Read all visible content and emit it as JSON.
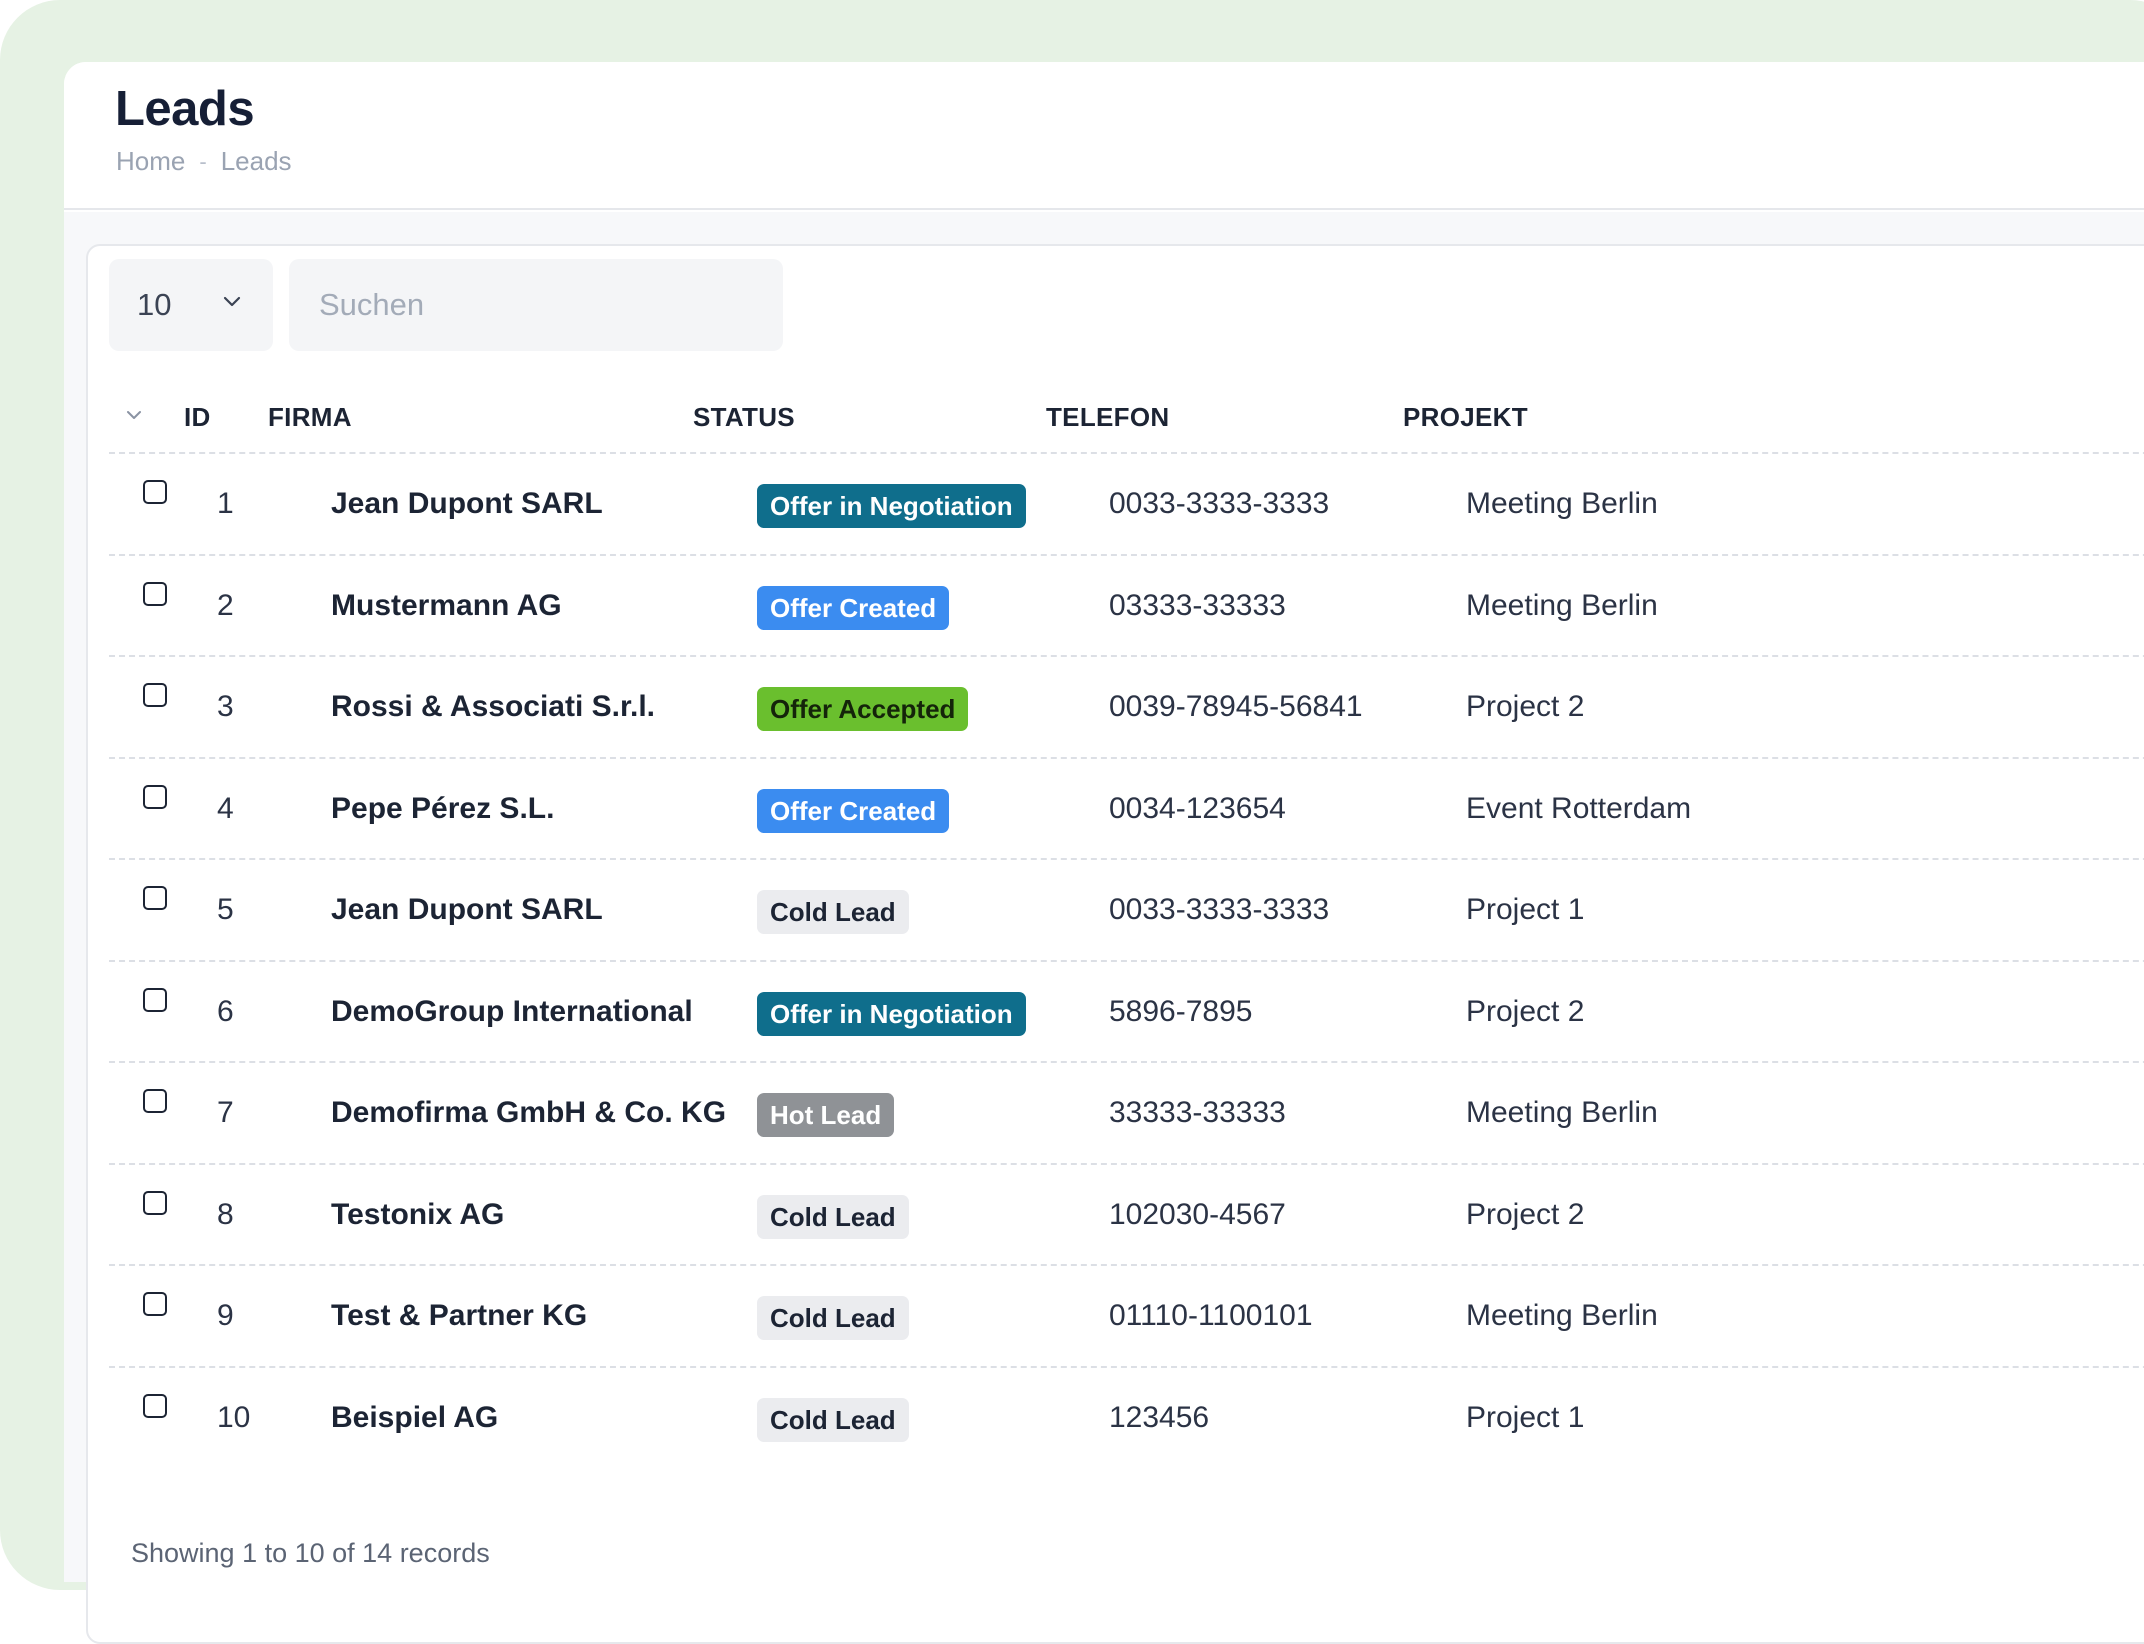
{
  "page": {
    "title": "Leads",
    "breadcrumb": [
      "Home",
      "Leads"
    ],
    "breadcrumb_separator": "-"
  },
  "toolbar": {
    "page_length": "10",
    "search_placeholder": "Suchen"
  },
  "table": {
    "columns": [
      "ID",
      "FIRMA",
      "STATUS",
      "TELEFON",
      "PROJEKT"
    ],
    "rows": [
      {
        "id": "1",
        "firma": "Jean Dupont SARL",
        "status": "Offer in Negotiation",
        "telefon": "0033-3333-3333",
        "projekt": "Meeting Berlin"
      },
      {
        "id": "2",
        "firma": "Mustermann AG",
        "status": "Offer Created",
        "telefon": "03333-33333",
        "projekt": "Meeting Berlin"
      },
      {
        "id": "3",
        "firma": "Rossi & Associati S.r.l.",
        "status": "Offer Accepted",
        "telefon": "0039-78945-56841",
        "projekt": "Project 2"
      },
      {
        "id": "4",
        "firma": "Pepe Pérez S.L.",
        "status": "Offer Created",
        "telefon": "0034-123654",
        "projekt": "Event Rotterdam"
      },
      {
        "id": "5",
        "firma": "Jean Dupont SARL",
        "status": "Cold Lead",
        "telefon": "0033-3333-3333",
        "projekt": "Project 1"
      },
      {
        "id": "6",
        "firma": "DemoGroup International",
        "status": "Offer in Negotiation",
        "telefon": "5896-7895",
        "projekt": "Project 2"
      },
      {
        "id": "7",
        "firma": "Demofirma GmbH & Co. KG",
        "status": "Hot Lead",
        "telefon": "33333-33333",
        "projekt": "Meeting Berlin"
      },
      {
        "id": "8",
        "firma": "Testonix AG",
        "status": "Cold Lead",
        "telefon": "102030-4567",
        "projekt": "Project 2"
      },
      {
        "id": "9",
        "firma": "Test & Partner KG",
        "status": "Cold Lead",
        "telefon": "01110-1100101",
        "projekt": "Meeting Berlin"
      },
      {
        "id": "10",
        "firma": "Beispiel AG",
        "status": "Cold Lead",
        "telefon": "123456",
        "projekt": "Project 1"
      }
    ]
  },
  "status_colors": {
    "Offer in Negotiation": {
      "bg": "#0f6e8c",
      "fg": "#ffffff"
    },
    "Offer Created": {
      "bg": "#3b8cf0",
      "fg": "#ffffff"
    },
    "Offer Accepted": {
      "bg": "#6abf2e",
      "fg": "#14240a"
    },
    "Cold Lead": {
      "bg": "#ebecef",
      "fg": "#1c2434"
    },
    "Hot Lead": {
      "bg": "#8f9296",
      "fg": "#ffffff"
    }
  },
  "footer": {
    "info": "Showing 1 to 10 of 14 records"
  }
}
